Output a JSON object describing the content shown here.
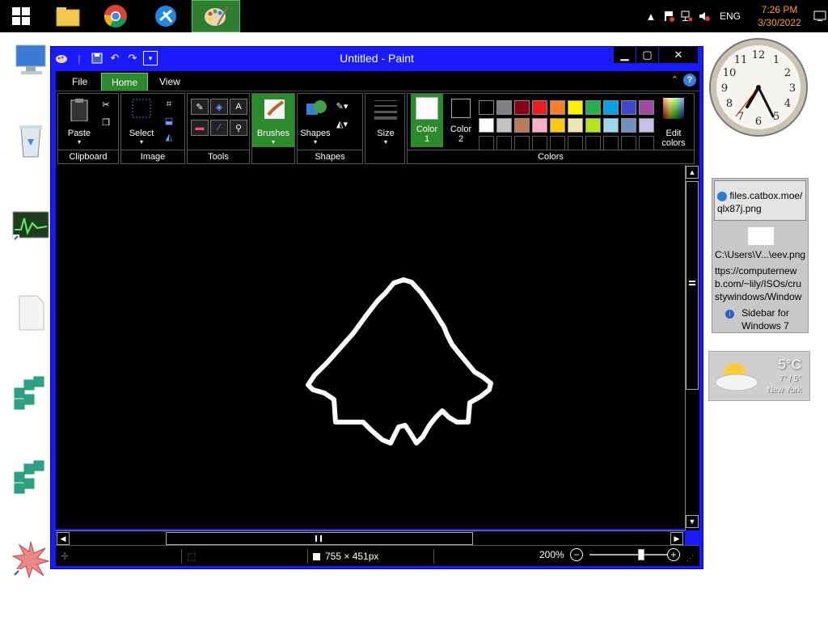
{
  "taskbar": {
    "time": "7:26 PM",
    "date": "3/30/2022",
    "language": "ENG"
  },
  "window": {
    "title": "Untitled - Paint",
    "tabs": {
      "file": "File",
      "home": "Home",
      "view": "View"
    },
    "help": "?",
    "ribbon": {
      "clipboard": {
        "label": "Clipboard",
        "paste": "Paste"
      },
      "image": {
        "label": "Image",
        "select": "Select"
      },
      "tools": {
        "label": "Tools"
      },
      "brushes": {
        "label": "Brushes"
      },
      "shapes": {
        "label": "Shapes",
        "button": "Shapes"
      },
      "size": {
        "label": "Size"
      },
      "colors": {
        "label": "Colors",
        "color1": [
          "Color",
          "1"
        ],
        "color2": [
          "Color",
          "2"
        ],
        "edit": [
          "Edit",
          "colors"
        ],
        "palette_row1": [
          "#000000",
          "#7f7f7f",
          "#880015",
          "#ed1c24",
          "#ff7f27",
          "#fff200",
          "#22b14c",
          "#00a2e8",
          "#3f48cc",
          "#a349a4"
        ],
        "palette_row2": [
          "#ffffff",
          "#c3c3c3",
          "#b97a57",
          "#ffaec9",
          "#ffc90e",
          "#efe4b0",
          "#b5e61d",
          "#99d9ea",
          "#7092be",
          "#c8bfe7"
        ]
      }
    },
    "status": {
      "dimensions": "755 × 451px",
      "zoom": "200%"
    }
  },
  "gadgets": {
    "feed": {
      "item1": [
        "files.catbox.moe/",
        "qlx87j.png"
      ],
      "item2": "C:\\Users\\V...\\eev.png",
      "item3": [
        "ttps://computernew",
        "b.com/~lily/ISOs/cru",
        "stywindows/Window"
      ],
      "item4": [
        "Sidebar for",
        "Windows 7"
      ]
    },
    "weather": {
      "temp": "5°C",
      "range": "7° / 5°",
      "city": "New York"
    }
  }
}
